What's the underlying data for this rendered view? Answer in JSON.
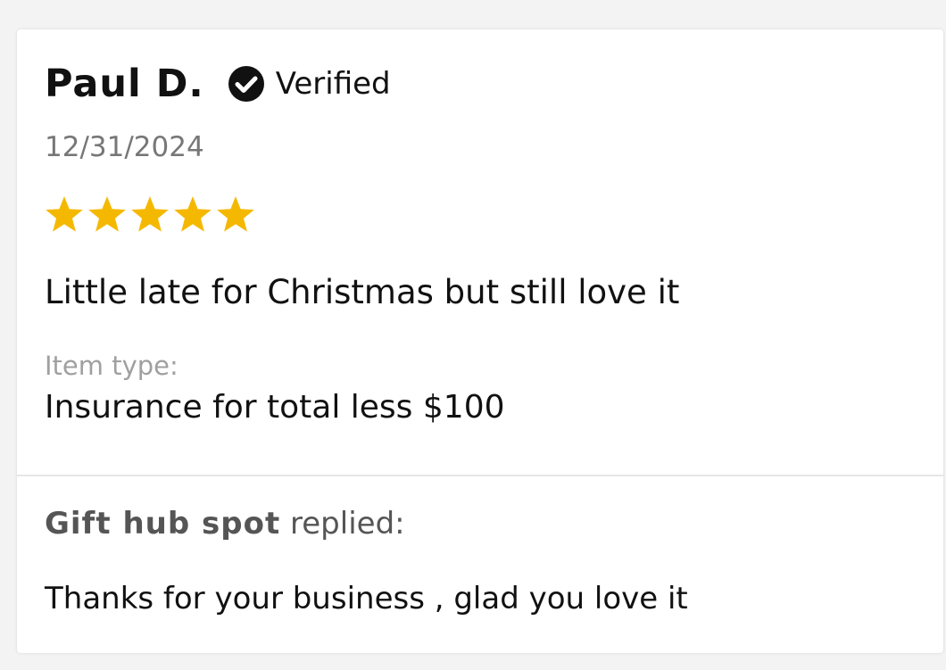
{
  "review": {
    "author": "Paul D.",
    "verified_label": "Verified",
    "date": "12/31/2024",
    "rating": 5,
    "rating_max": 5,
    "star_color": "#F5B800",
    "title": "Little late for Christmas but still love it",
    "item_type_label": "Item type:",
    "item_type_value": "Insurance for total less $100"
  },
  "reply": {
    "author": "Gift hub spot",
    "suffix": "replied:",
    "body": "Thanks for your business , glad you love it"
  },
  "icons": {
    "verified": "check-circle-icon",
    "rating": "star-icon"
  }
}
